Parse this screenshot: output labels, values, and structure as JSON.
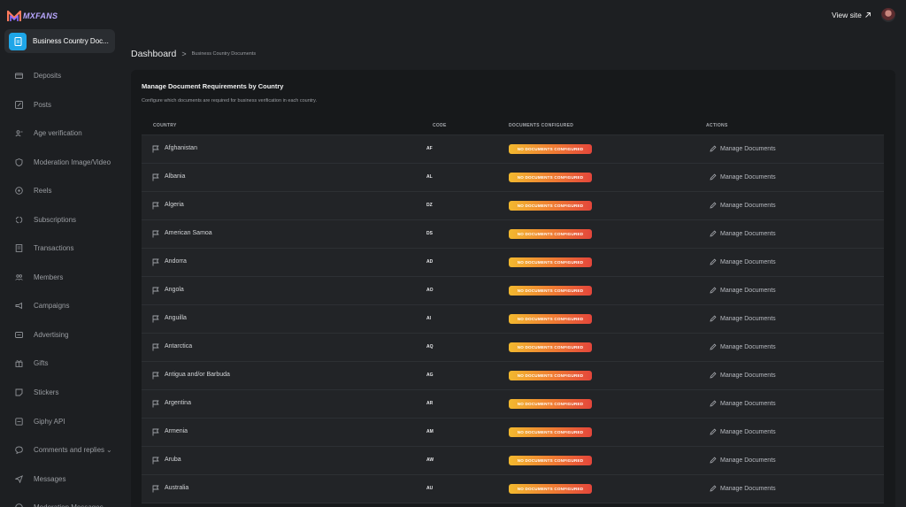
{
  "brand": {
    "name": "MXFANS",
    "accent": "#b9a7ff",
    "logo_icon": "mx-logo-icon"
  },
  "sidebar": {
    "active": {
      "label": "Business Country Doc...",
      "icon": "document-icon",
      "color": "#1ea6e8"
    },
    "items": [
      {
        "label": "Deposits",
        "icon": "wallet-icon"
      },
      {
        "label": "Posts",
        "icon": "edit-icon"
      },
      {
        "label": "Age verification",
        "icon": "user-id-icon"
      },
      {
        "label": "Moderation Image/Video",
        "icon": "shield-icon"
      },
      {
        "label": "Reels",
        "icon": "play-circle-icon"
      },
      {
        "label": "Subscriptions",
        "icon": "refresh-icon"
      },
      {
        "label": "Transactions",
        "icon": "receipt-icon"
      },
      {
        "label": "Members",
        "icon": "users-icon"
      },
      {
        "label": "Campaigns",
        "icon": "megaphone-icon"
      },
      {
        "label": "Advertising",
        "icon": "ad-icon"
      },
      {
        "label": "Gifts",
        "icon": "gift-icon"
      },
      {
        "label": "Stickers",
        "icon": "sticker-icon"
      },
      {
        "label": "Giphy API",
        "icon": "gif-icon"
      },
      {
        "label": "Comments and replies",
        "icon": "comment-icon"
      },
      {
        "label": "Messages",
        "icon": "send-icon"
      },
      {
        "label": "Moderation Messages",
        "icon": "shield-message-icon"
      }
    ]
  },
  "header": {
    "view_site": "View site",
    "avatar": "avatar"
  },
  "breadcrumb": {
    "root": "Dashboard",
    "current": "Business Country Documents"
  },
  "card": {
    "title": "Manage Document Requirements by Country",
    "description": "Configure which documents are required for business verification in each country."
  },
  "table": {
    "columns": [
      "COUNTRY",
      "CODE",
      "DOCUMENTS CONFIGURED",
      "ACTIONS"
    ],
    "action_label": "Manage Documents",
    "rows": [
      {
        "country": "Afghanistan",
        "code": "AF",
        "status": "NO DOCUMENTS CONFIGURED"
      },
      {
        "country": "Albania",
        "code": "AL",
        "status": "NO DOCUMENTS CONFIGURED"
      },
      {
        "country": "Algeria",
        "code": "DZ",
        "status": "NO DOCUMENTS CONFIGURED"
      },
      {
        "country": "American Samoa",
        "code": "DS",
        "status": "NO DOCUMENTS CONFIGURED"
      },
      {
        "country": "Andorra",
        "code": "AD",
        "status": "NO DOCUMENTS CONFIGURED"
      },
      {
        "country": "Angola",
        "code": "AO",
        "status": "NO DOCUMENTS CONFIGURED"
      },
      {
        "country": "Anguilla",
        "code": "AI",
        "status": "NO DOCUMENTS CONFIGURED"
      },
      {
        "country": "Antarctica",
        "code": "AQ",
        "status": "NO DOCUMENTS CONFIGURED"
      },
      {
        "country": "Antigua and/or Barbuda",
        "code": "AG",
        "status": "NO DOCUMENTS CONFIGURED"
      },
      {
        "country": "Argentina",
        "code": "AR",
        "status": "NO DOCUMENTS CONFIGURED"
      },
      {
        "country": "Armenia",
        "code": "AM",
        "status": "NO DOCUMENTS CONFIGURED"
      },
      {
        "country": "Aruba",
        "code": "AW",
        "status": "NO DOCUMENTS CONFIGURED"
      },
      {
        "country": "Australia",
        "code": "AU",
        "status": "NO DOCUMENTS CONFIGURED"
      }
    ]
  },
  "colors": {
    "background": "#1d1f22",
    "card": "#17191b",
    "row": "#222427",
    "badge_start": "#f2b92f",
    "badge_end": "#e4463b"
  }
}
